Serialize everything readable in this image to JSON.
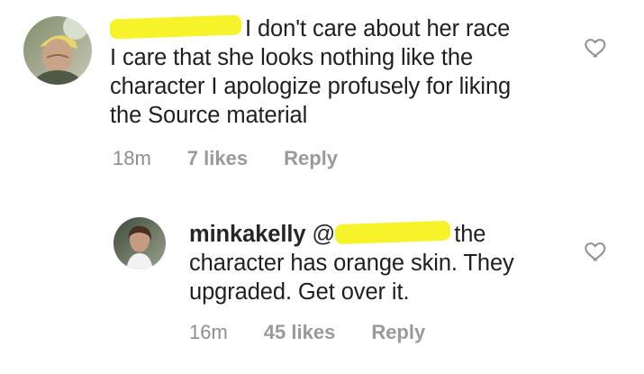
{
  "comments": [
    {
      "username": "",
      "text_lines": [
        "I don't care about her race",
        "I care that she looks nothing like the",
        "character I apologize profusely for liking",
        "the Source material"
      ],
      "time": "18m",
      "likes": "7 likes",
      "reply_label": "Reply"
    },
    {
      "username": "minkakelly",
      "mention_prefix": "@",
      "text_after_mention": "the",
      "text_lines": [
        "character has orange skin. They",
        "upgraded. Get over it."
      ],
      "time": "16m",
      "likes": "45 likes",
      "reply_label": "Reply"
    }
  ],
  "colors": {
    "redaction": "#f6f32a",
    "meta_text": "#8e8e8e",
    "body_text": "#1f1f1f",
    "heart_stroke": "#8e8e8e"
  },
  "icons": {
    "heart": "heart-outline-icon"
  }
}
